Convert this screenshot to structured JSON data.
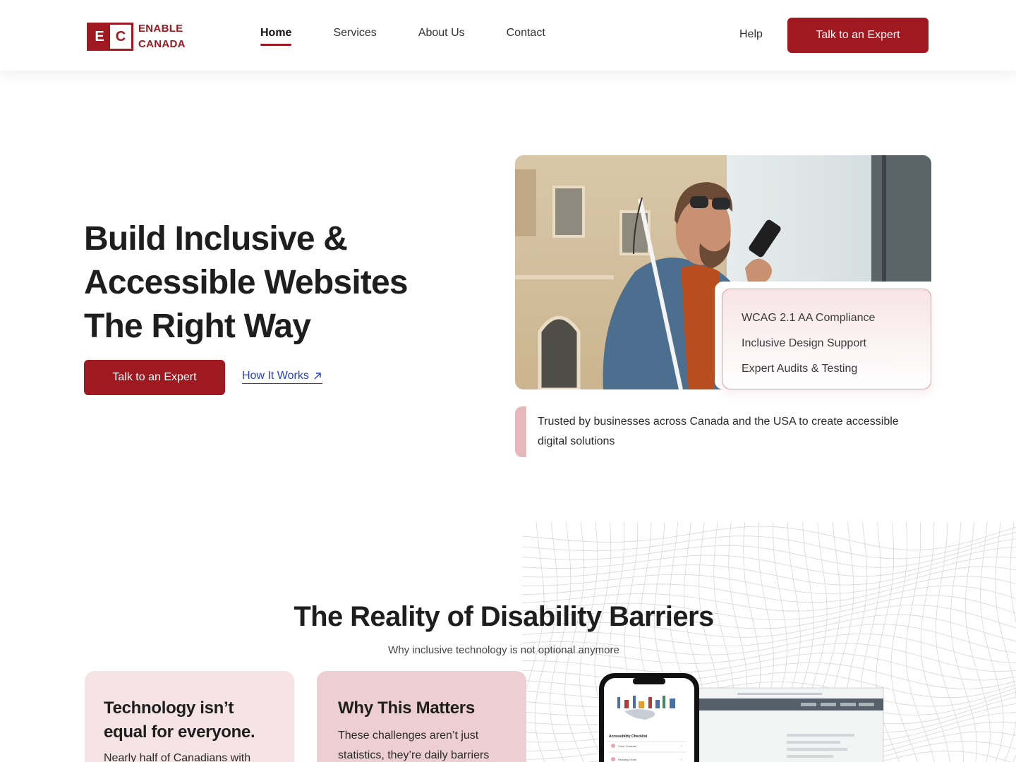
{
  "brand": {
    "logo_letters": [
      "E",
      "C"
    ],
    "name_line1": "ENABLE",
    "name_line2": "CANADA",
    "accent": "#a01820"
  },
  "nav": {
    "items": [
      {
        "label": "Home",
        "active": true
      },
      {
        "label": "Services",
        "active": false
      },
      {
        "label": "About Us",
        "active": false
      },
      {
        "label": "Contact",
        "active": false
      }
    ],
    "help_label": "Help",
    "cta_label": "Talk to an Expert"
  },
  "hero": {
    "title_line1": "Build Inclusive &",
    "title_line2": "Accessible Websites",
    "title_line3": "The Right Way",
    "cta_label": "Talk to an Expert",
    "link_label": "How It Works",
    "features": [
      "WCAG 2.1 AA Compliance",
      "Inclusive Design Support",
      "Expert Audits & Testing"
    ],
    "trusted_text": "Trusted by businesses across Canada and the USA to create accessible digital solutions"
  },
  "section": {
    "title": "The Reality of Disability Barriers",
    "subtitle": "Why inclusive technology is not optional anymore",
    "cards": [
      {
        "title": "Technology isn’t equal for everyone.",
        "body": "Nearly half of Canadians with"
      },
      {
        "title": "Why This Matters",
        "body": "These challenges aren’t just statistics, they’re daily barriers"
      }
    ],
    "mockup": {
      "checklist_title": "Accessibility Checklist",
      "row1": "Color Contrast",
      "row2": "Heading Order"
    }
  }
}
